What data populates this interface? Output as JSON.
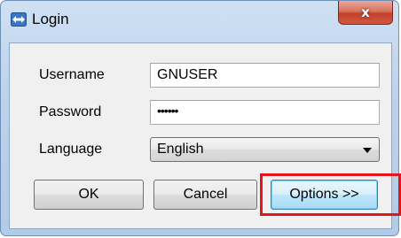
{
  "window": {
    "title": "Login",
    "close_label": "x"
  },
  "form": {
    "username_label": "Username",
    "username_value": "GNUSER",
    "password_label": "Password",
    "password_masked": "••••••",
    "language_label": "Language",
    "language_selected": "English"
  },
  "buttons": {
    "ok_label": "OK",
    "cancel_label": "Cancel",
    "options_label": "Options >>"
  },
  "colors": {
    "highlight": "#e8141c",
    "close_button": "#c3402a",
    "title_bar": "#bcd3ec"
  },
  "icons": {
    "app_icon": "double-arrow-icon"
  }
}
